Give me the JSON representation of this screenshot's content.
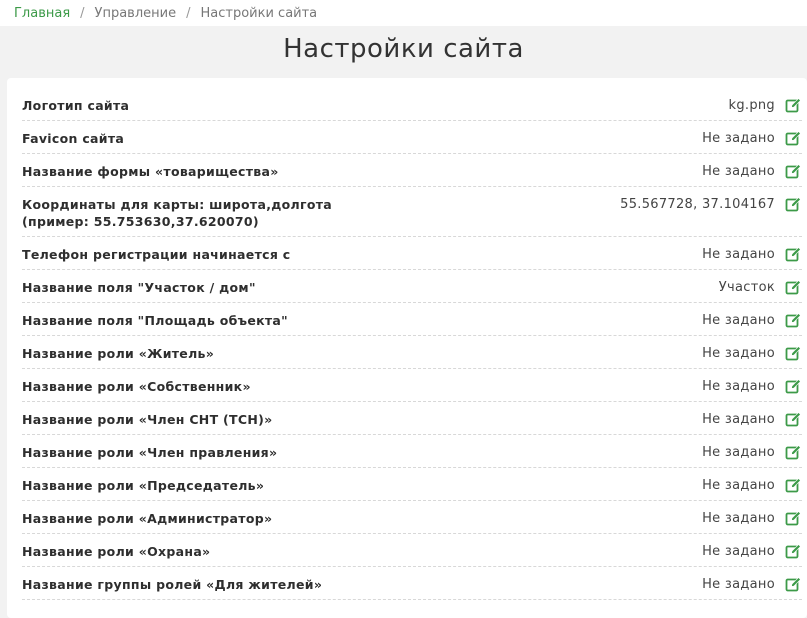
{
  "breadcrumb": {
    "items": [
      "Главная",
      "Управление",
      "Настройки сайта"
    ],
    "separator": "/"
  },
  "page_title": "Настройки сайта",
  "colors": {
    "accent": "#3c9a48"
  },
  "icons": {
    "edit": "edit-icon"
  },
  "settings": [
    {
      "label": "Логотип сайта",
      "value": "kg.png"
    },
    {
      "label": "Favicon сайта",
      "value": "Не задано"
    },
    {
      "label": "Название формы «товарищества»",
      "value": "Не задано"
    },
    {
      "label": "Координаты для карты: широта,долгота",
      "label2": "(пример: 55.753630,37.620070)",
      "value": "55.567728, 37.104167"
    },
    {
      "label": "Телефон регистрации начинается с",
      "value": "Не задано"
    },
    {
      "label": "Название поля \"Участок / дом\"",
      "value": "Участок"
    },
    {
      "label": "Название поля \"Площадь объекта\"",
      "value": "Не задано"
    },
    {
      "label": "Название роли «Житель»",
      "value": "Не задано"
    },
    {
      "label": "Название роли «Собственник»",
      "value": "Не задано"
    },
    {
      "label": "Название роли «Член СНТ (ТСН)»",
      "value": "Не задано"
    },
    {
      "label": "Название роли «Член правления»",
      "value": "Не задано"
    },
    {
      "label": "Название роли «Председатель»",
      "value": "Не задано"
    },
    {
      "label": "Название роли «Администратор»",
      "value": "Не задано"
    },
    {
      "label": "Название роли «Охрана»",
      "value": "Не задано"
    },
    {
      "label": "Название группы ролей «Для жителей»",
      "value": "Не задано"
    }
  ]
}
